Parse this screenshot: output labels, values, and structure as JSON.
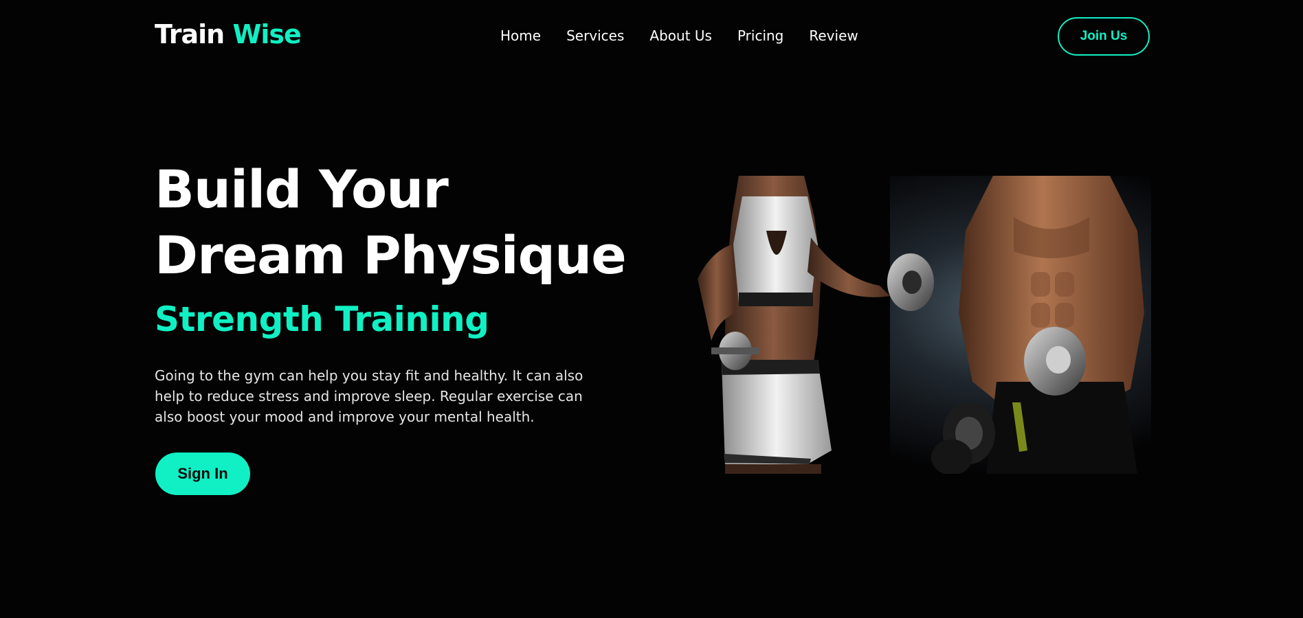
{
  "nav": {
    "logo_primary": "Train",
    "logo_accent": "Wise",
    "links": [
      "Home",
      "Services",
      "About Us",
      "Pricing",
      "Review"
    ],
    "join_label": "Join Us"
  },
  "hero": {
    "title_line1": "Build Your",
    "title_line2": "Dream Physique",
    "subtitle": "Strength Training",
    "description": "Going to the gym can help you stay fit and healthy. It can also help to reduce stress and improve sleep. Regular exercise can also boost your mood and improve your mental health.",
    "cta_label": "Sign In"
  },
  "colors": {
    "accent": "#10f0c4",
    "background": "#030304",
    "text": "#ffffff"
  }
}
